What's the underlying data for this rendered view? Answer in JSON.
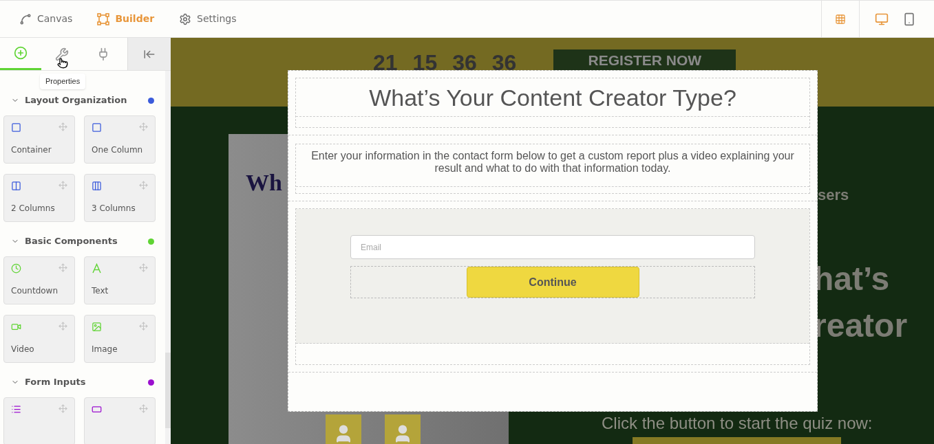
{
  "top_nav": [
    {
      "label": "Canvas",
      "kind": "canvas",
      "selected": false
    },
    {
      "label": "Builder",
      "kind": "builder",
      "selected": true
    },
    {
      "label": "Settings",
      "kind": "settings",
      "selected": false
    }
  ],
  "view_toggles": [
    {
      "kind": "grid",
      "selected": true
    },
    {
      "kind": "desktop",
      "selected": true
    },
    {
      "kind": "mobile",
      "selected": false
    }
  ],
  "panel_tabs": [
    {
      "kind": "add",
      "selected": true
    },
    {
      "kind": "tools",
      "selected": false
    },
    {
      "kind": "plug",
      "selected": false
    }
  ],
  "tooltip": "Properties",
  "sections": [
    {
      "title": "Layout Organization",
      "color": "#3b5bdb",
      "items": [
        {
          "kind": "square",
          "label": "Container"
        },
        {
          "kind": "square",
          "label": "One Column"
        },
        {
          "kind": "two",
          "label": "2 Columns"
        },
        {
          "kind": "three",
          "label": "3 Columns"
        }
      ]
    },
    {
      "title": "Basic Components",
      "color": "#5fd433",
      "items": [
        {
          "kind": "clock",
          "label": "Countdown"
        },
        {
          "kind": "text",
          "label": "Text"
        },
        {
          "kind": "video",
          "label": "Video"
        },
        {
          "kind": "image",
          "label": "Image"
        }
      ]
    },
    {
      "title": "Form Inputs",
      "color": "#9b0fcf",
      "items": [
        {
          "kind": "list"
        },
        {
          "kind": "input"
        }
      ]
    }
  ],
  "page": {
    "countdown": [
      "21",
      "15",
      "36",
      "36"
    ],
    "register_button": "REGISTER NOW",
    "card_heading": "Wh",
    "right_texts": [
      "sers",
      "hat’s",
      "reator"
    ],
    "cta_text": "Click the button to start the quiz now:"
  },
  "popup": {
    "title": "What’s Your Content Creator Type?",
    "description": "Enter your  information in the contact form below to get a custom report plus a video explaining your result and what to do with that information today.",
    "email": {
      "placeholder": "Email"
    },
    "button": "Continue"
  }
}
